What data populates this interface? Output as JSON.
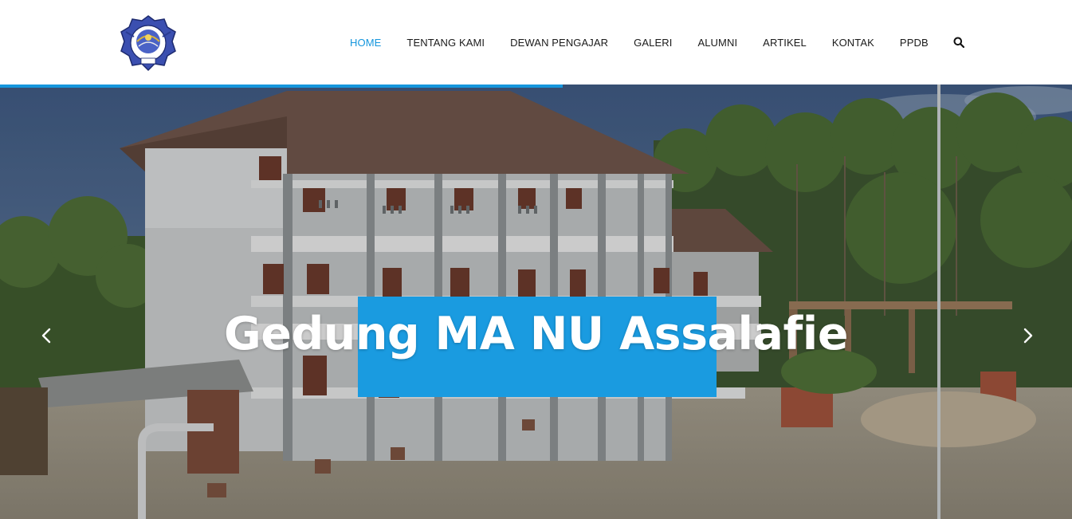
{
  "header": {
    "logo_icon": "school-crest-logo",
    "nav": [
      {
        "label": "HOME",
        "active": true
      },
      {
        "label": "TENTANG KAMI",
        "active": false
      },
      {
        "label": "DEWAN PENGAJAR",
        "active": false
      },
      {
        "label": "GALERI",
        "active": false
      },
      {
        "label": "ALUMNI",
        "active": false
      },
      {
        "label": "ARTIKEL",
        "active": false
      },
      {
        "label": "KONTAK",
        "active": false
      },
      {
        "label": "PPDB",
        "active": false
      }
    ],
    "search_icon": "search-icon"
  },
  "slider": {
    "progress": 0.525,
    "caption": "Gedung MA NU Assalafie",
    "prev_icon": "chevron-left-icon",
    "next_icon": "chevron-right-icon"
  },
  "colors": {
    "accent": "#1596dd",
    "caption_bg": "#1a9be0",
    "nav_text": "#1b1b1b"
  }
}
